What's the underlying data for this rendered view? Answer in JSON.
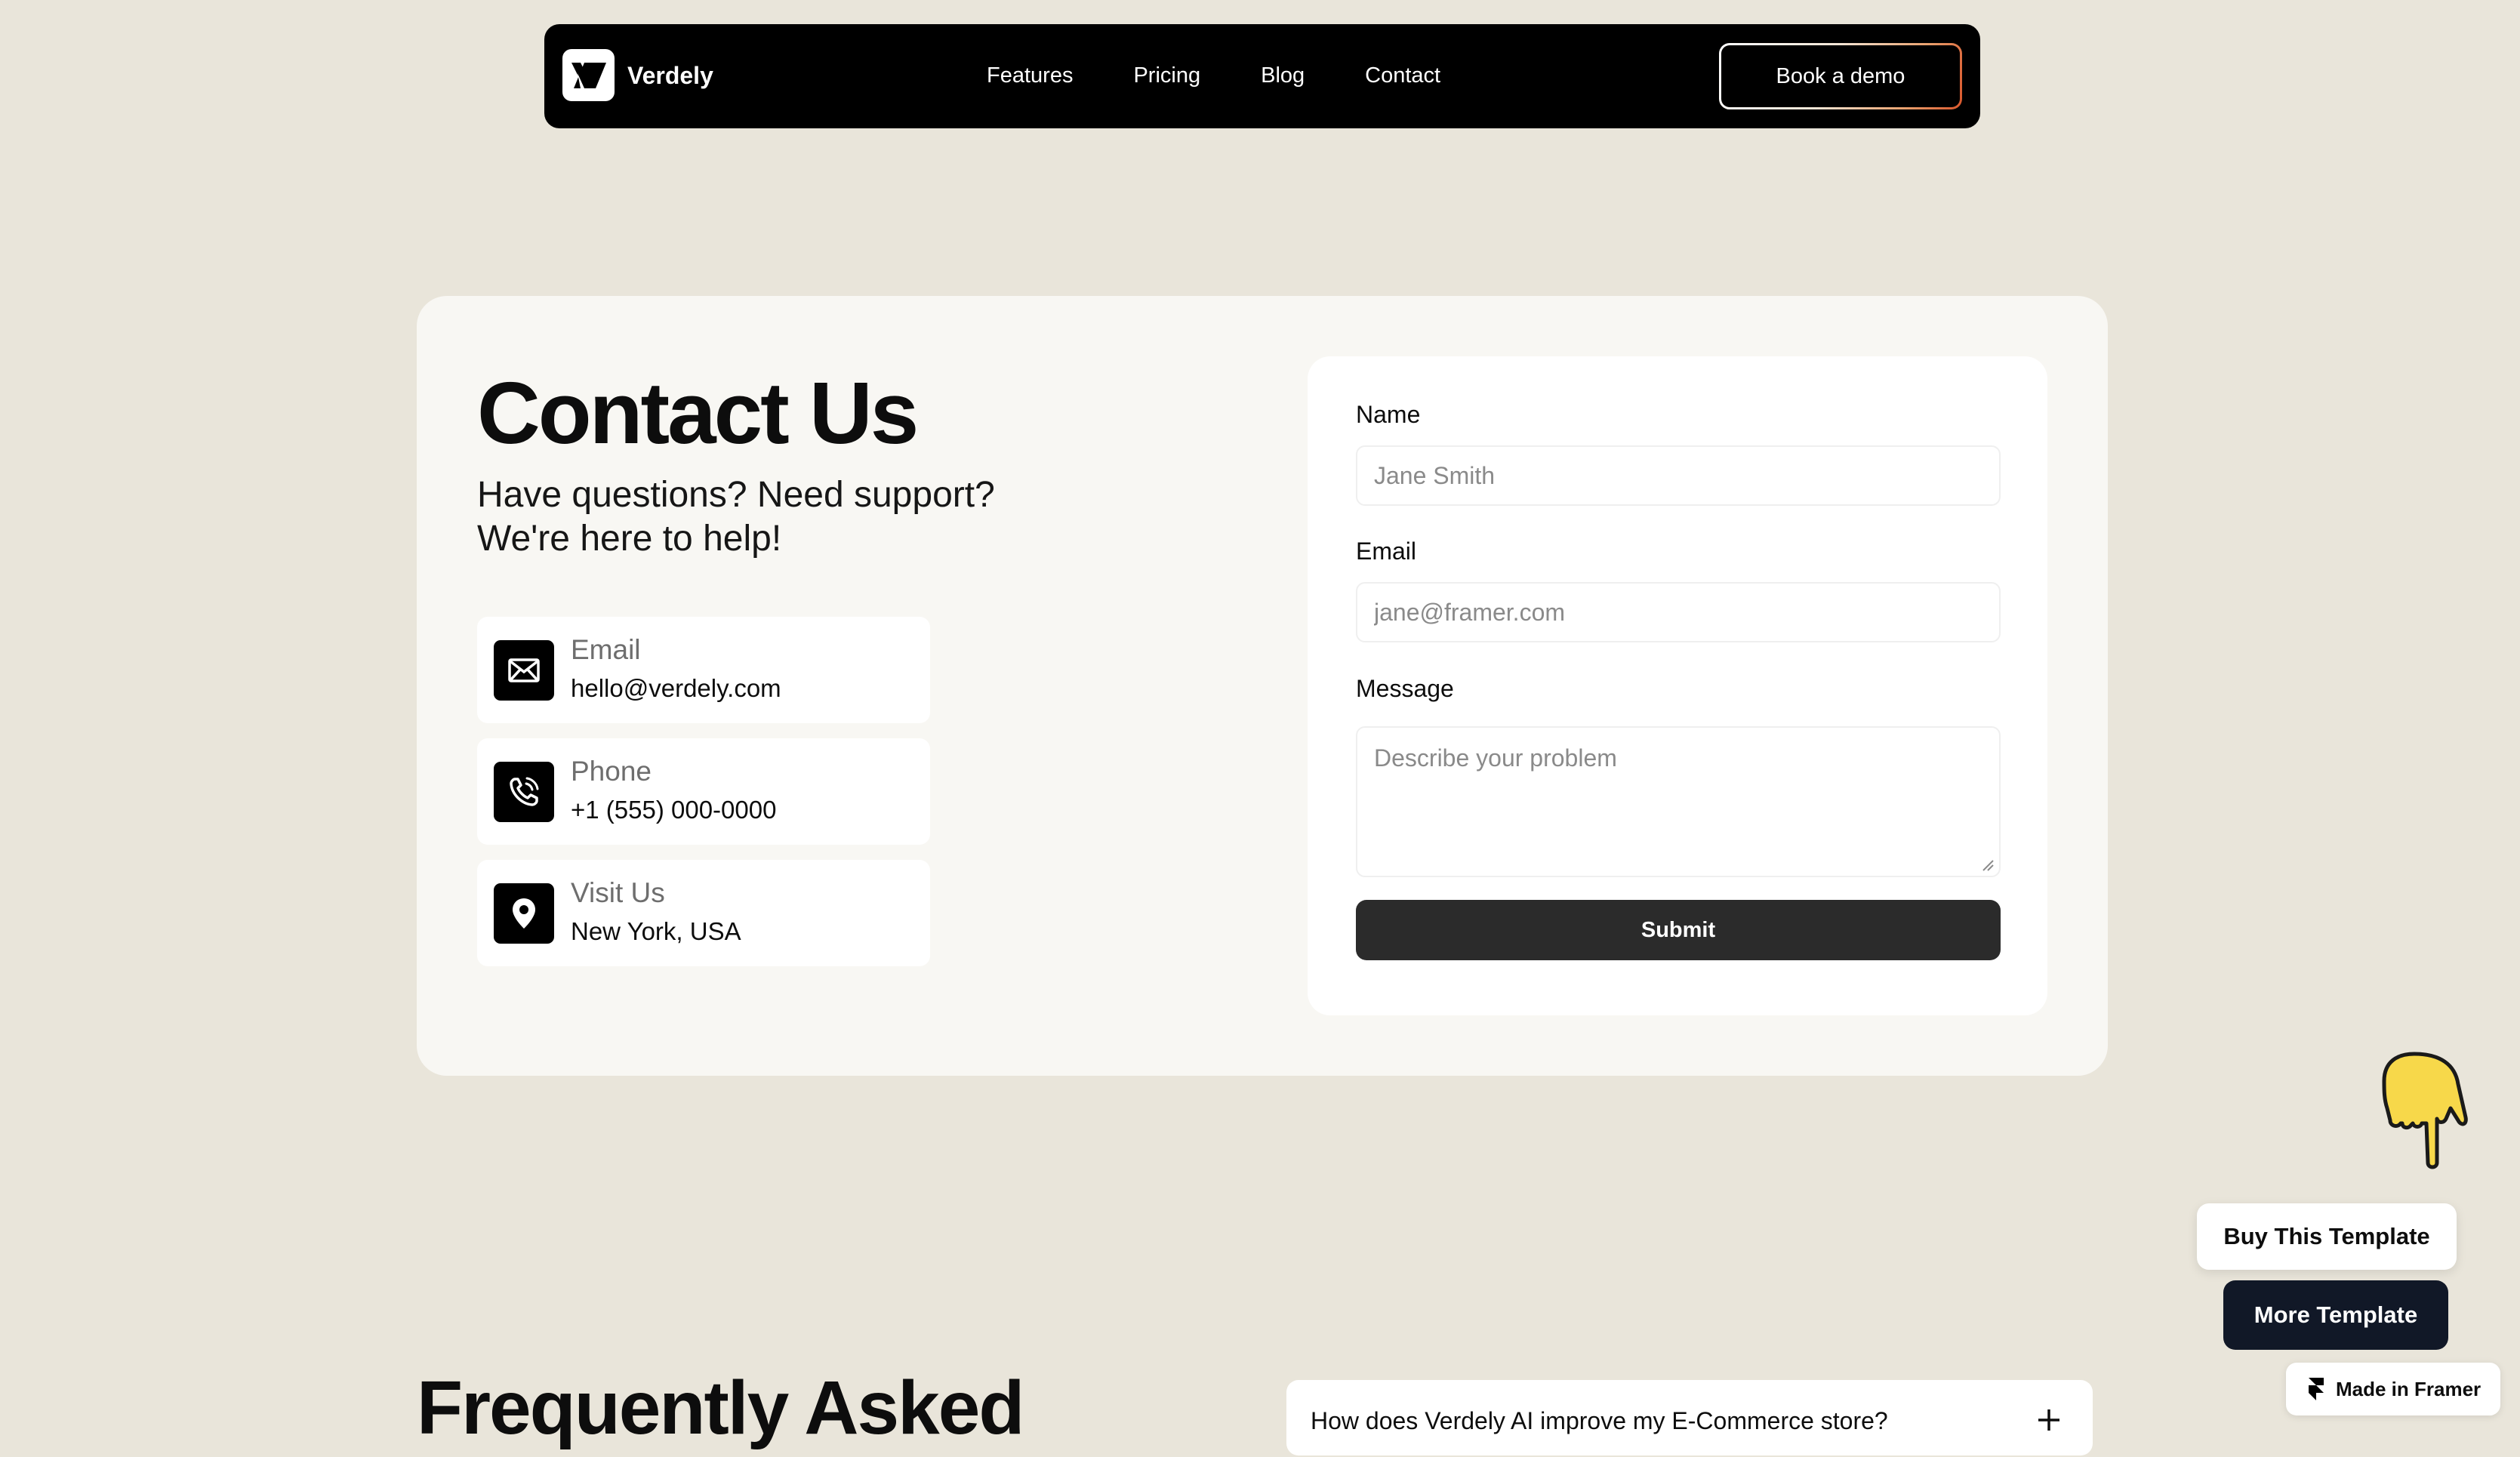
{
  "nav": {
    "brand": "Verdely",
    "links": [
      "Features",
      "Pricing",
      "Blog",
      "Contact"
    ],
    "cta": "Book a demo"
  },
  "contact": {
    "title": "Contact Us",
    "subtitle": "Have questions? Need support? We're here to help!",
    "info": [
      {
        "label": "Email",
        "value": "hello@verdely.com",
        "icon": "mail-icon"
      },
      {
        "label": "Phone",
        "value": "+1 (555) 000-0000",
        "icon": "phone-icon"
      },
      {
        "label": "Visit Us",
        "value": "New York, USA",
        "icon": "location-pin-icon"
      }
    ]
  },
  "form": {
    "name_label": "Name",
    "name_placeholder": "Jane Smith",
    "email_label": "Email",
    "email_placeholder": "jane@framer.com",
    "message_label": "Message",
    "message_placeholder": "Describe your problem",
    "submit_label": "Submit"
  },
  "faq": {
    "title": "Frequently Asked",
    "items": [
      {
        "question": "How does Verdely AI improve my E-Commerce store?"
      }
    ]
  },
  "floating": {
    "buy_label": "Buy This Template",
    "more_label": "More Template",
    "framer_badge": "Made in Framer"
  },
  "colors": {
    "page_background": "#e9e5da",
    "card_background": "#f8f7f3",
    "navbar": "#000000",
    "submit_button": "#2b2b2b",
    "more_button": "#111827",
    "hand_icon": "#f7d84a"
  }
}
